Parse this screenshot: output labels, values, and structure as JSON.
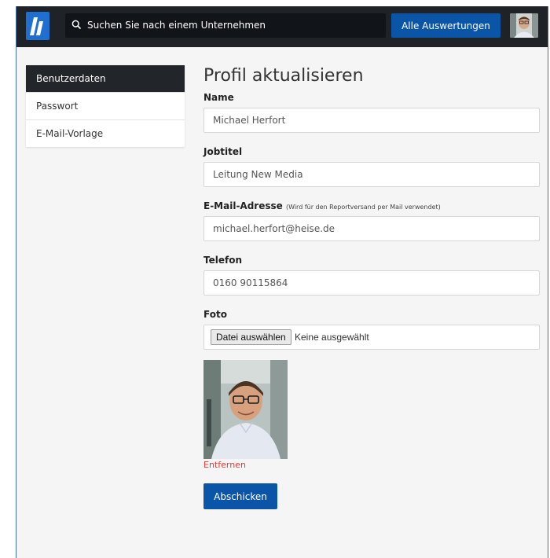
{
  "header": {
    "search_placeholder": "Suchen Sie nach einem Unternehmen",
    "all_reports_label": "Alle Auswertungen"
  },
  "sidebar": {
    "items": [
      {
        "label": "Benutzerdaten",
        "active": true
      },
      {
        "label": "Passwort",
        "active": false
      },
      {
        "label": "E-Mail-Vorlage",
        "active": false
      }
    ]
  },
  "form": {
    "title": "Profil aktualisieren",
    "name": {
      "label": "Name",
      "value": "Michael Herfort"
    },
    "jobtitle": {
      "label": "Jobtitel",
      "value": "Leitung New Media"
    },
    "email": {
      "label": "E-Mail-Adresse",
      "hint": "(Wird für den Reportversand per Mail verwendet)",
      "value": "michael.herfort@heise.de"
    },
    "phone": {
      "label": "Telefon",
      "value": "0160 90115864"
    },
    "photo": {
      "label": "Foto",
      "choose_label": "Datei auswählen",
      "status": "Keine ausgewählt"
    },
    "remove_label": "Entfernen",
    "submit_label": "Abschicken"
  },
  "colors": {
    "accent": "#0b55a8",
    "topbar": "#1f2328",
    "danger": "#e53935"
  },
  "icons": {
    "logo": "brand-logo-icon",
    "search": "search-icon"
  }
}
